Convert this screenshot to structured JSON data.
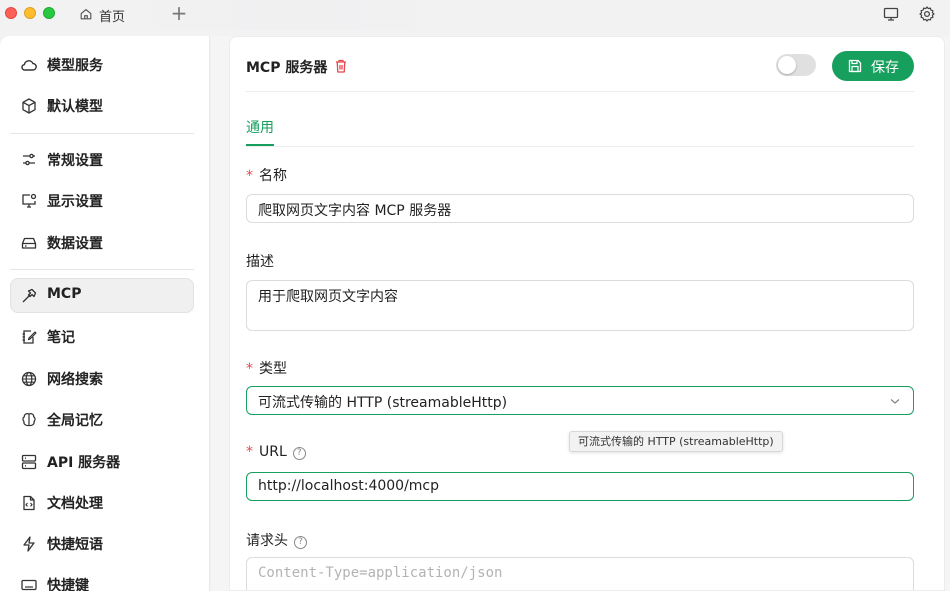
{
  "titlebar": {
    "tab_label": "首页",
    "new_tab_symbol": "+",
    "icons": [
      "home-icon",
      "monitor-icon",
      "gear-icon"
    ]
  },
  "sidebar": {
    "items": [
      {
        "label": "模型服务",
        "icon": "cloud-icon"
      },
      {
        "label": "默认模型",
        "icon": "cube-icon"
      },
      {
        "label": "常规设置",
        "icon": "sliders-icon"
      },
      {
        "label": "显示设置",
        "icon": "display-settings-icon"
      },
      {
        "label": "数据设置",
        "icon": "storage-icon"
      },
      {
        "label": "MCP",
        "icon": "hammer-icon",
        "active": true
      },
      {
        "label": "笔记",
        "icon": "note-icon"
      },
      {
        "label": "网络搜索",
        "icon": "globe-icon"
      },
      {
        "label": "全局记忆",
        "icon": "brain-icon"
      },
      {
        "label": "API 服务器",
        "icon": "server-icon"
      },
      {
        "label": "文档处理",
        "icon": "file-code-icon"
      },
      {
        "label": "快捷短语",
        "icon": "zap-icon"
      },
      {
        "label": "快捷键",
        "icon": "keyboard-icon"
      }
    ]
  },
  "header": {
    "title": "MCP 服务器",
    "save_label": "保存",
    "enabled": false
  },
  "tabs": [
    {
      "label": "通用",
      "active": true
    }
  ],
  "form": {
    "name_label": "名称",
    "name_value": "爬取网页文字内容 MCP 服务器",
    "desc_label": "描述",
    "desc_value": "用于爬取网页文字内容",
    "type_label": "类型",
    "type_value": "可流式传输的 HTTP (streamableHttp)",
    "type_tooltip": "可流式传输的 HTTP (streamableHttp)",
    "url_label": "URL",
    "url_value": "http://localhost:4000/mcp",
    "headers_label": "请求头",
    "headers_placeholder": "Content-Type=application/json",
    "required_mark": "*",
    "help_symbol": "?"
  },
  "colors": {
    "accent": "#17a05d",
    "required": "#e5484d",
    "delete": "#e5484d"
  }
}
